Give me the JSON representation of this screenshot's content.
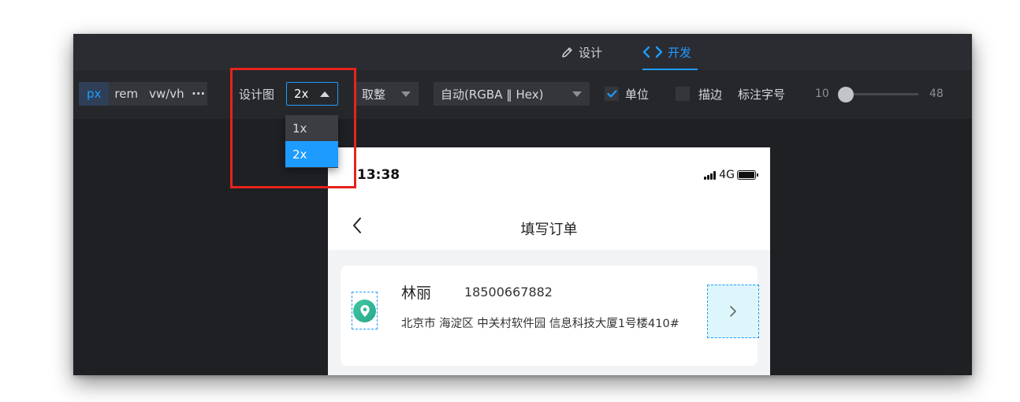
{
  "topbar": {
    "design_tab": {
      "label": "设计",
      "icon": "pencil-icon"
    },
    "dev_tab": {
      "label": "开发",
      "icon": "code-brackets-icon",
      "active": true
    }
  },
  "toolbar": {
    "units": [
      {
        "label": "px",
        "active": true
      },
      {
        "label": "rem",
        "active": false
      },
      {
        "label": "vw/vh",
        "active": false
      }
    ],
    "units_more": "···",
    "design_label": "设计图",
    "design_scale": {
      "value": "2x",
      "options": [
        "1x",
        "2x"
      ],
      "selected": "2x",
      "open": true
    },
    "rounding": {
      "value": "取整"
    },
    "color_format": {
      "value": "自动(RGBA ‖ Hex)"
    },
    "unit_checkbox": {
      "label": "单位",
      "checked": true
    },
    "stroke_checkbox": {
      "label": "描边",
      "checked": false
    },
    "font_size_label": "标注字号",
    "font_size_slider": {
      "min": "10",
      "max": "48",
      "value": 10
    }
  },
  "phone": {
    "status_bar": {
      "time": "13:38",
      "network": "4G"
    },
    "nav": {
      "title": "填写订单"
    },
    "address": {
      "name": "林丽",
      "phone": "18500667882",
      "detail": "北京市 海淀区 中关村软件园 信息科技大厦1号楼410#"
    }
  },
  "colors": {
    "accent": "#1e9bff",
    "highlight": "#e5241d",
    "toolbar_bg": "#26272b",
    "canvas_bg": "#1f2024",
    "location_icon": "#3cc9a0"
  }
}
